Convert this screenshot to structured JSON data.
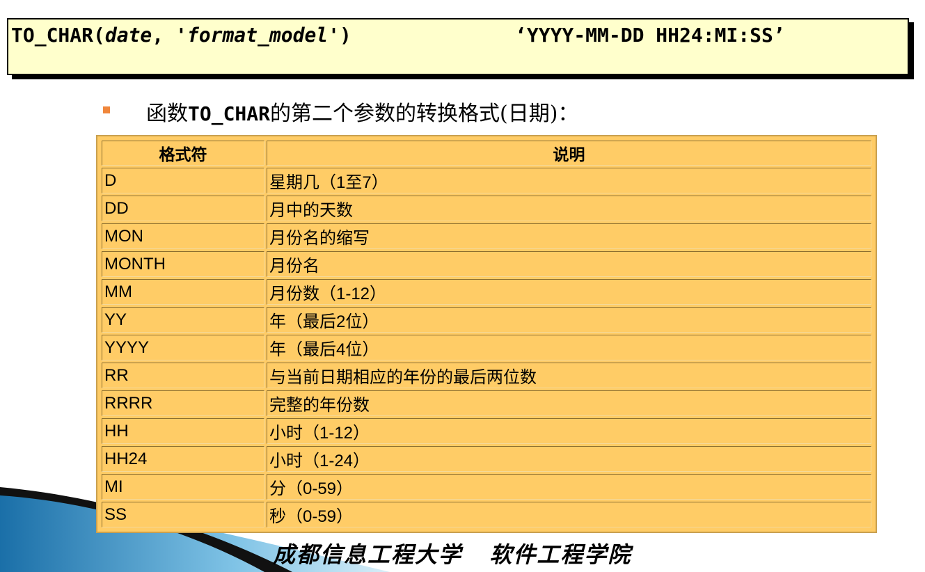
{
  "code": {
    "prefix": "TO_CHAR(",
    "arg1": "date",
    "sep": ", '",
    "arg2": "format_model",
    "suffix": "')",
    "format_example": "‘YYYY-MM-DD HH24:MI:SS’"
  },
  "bullet": {
    "pre": "函数",
    "func": "TO_CHAR",
    "post": "的第二个参数的转换格式(日期)："
  },
  "table": {
    "headers": [
      "格式符",
      "说明"
    ],
    "rows": [
      [
        "D",
        "星期几（1至7）"
      ],
      [
        "DD",
        "月中的天数"
      ],
      [
        "MON",
        "月份名的缩写"
      ],
      [
        "MONTH",
        "月份名"
      ],
      [
        "MM",
        "月份数（1-12）"
      ],
      [
        "YY",
        "年（最后2位）"
      ],
      [
        "YYYY",
        "年（最后4位）"
      ],
      [
        "RR",
        "与当前日期相应的年份的最后两位数"
      ],
      [
        "RRRR",
        "完整的年份数"
      ],
      [
        "HH",
        "小时（1-12）"
      ],
      [
        "HH24",
        "小时（1-24）"
      ],
      [
        "MI",
        "分（0-59）"
      ],
      [
        "SS",
        "秒（0-59）"
      ]
    ]
  },
  "footer": "成都信息工程大学   软件工程学院",
  "colors": {
    "table_bg": "#ffcc66",
    "code_bg": "#ffffcc",
    "bullet": "#f0863b"
  }
}
